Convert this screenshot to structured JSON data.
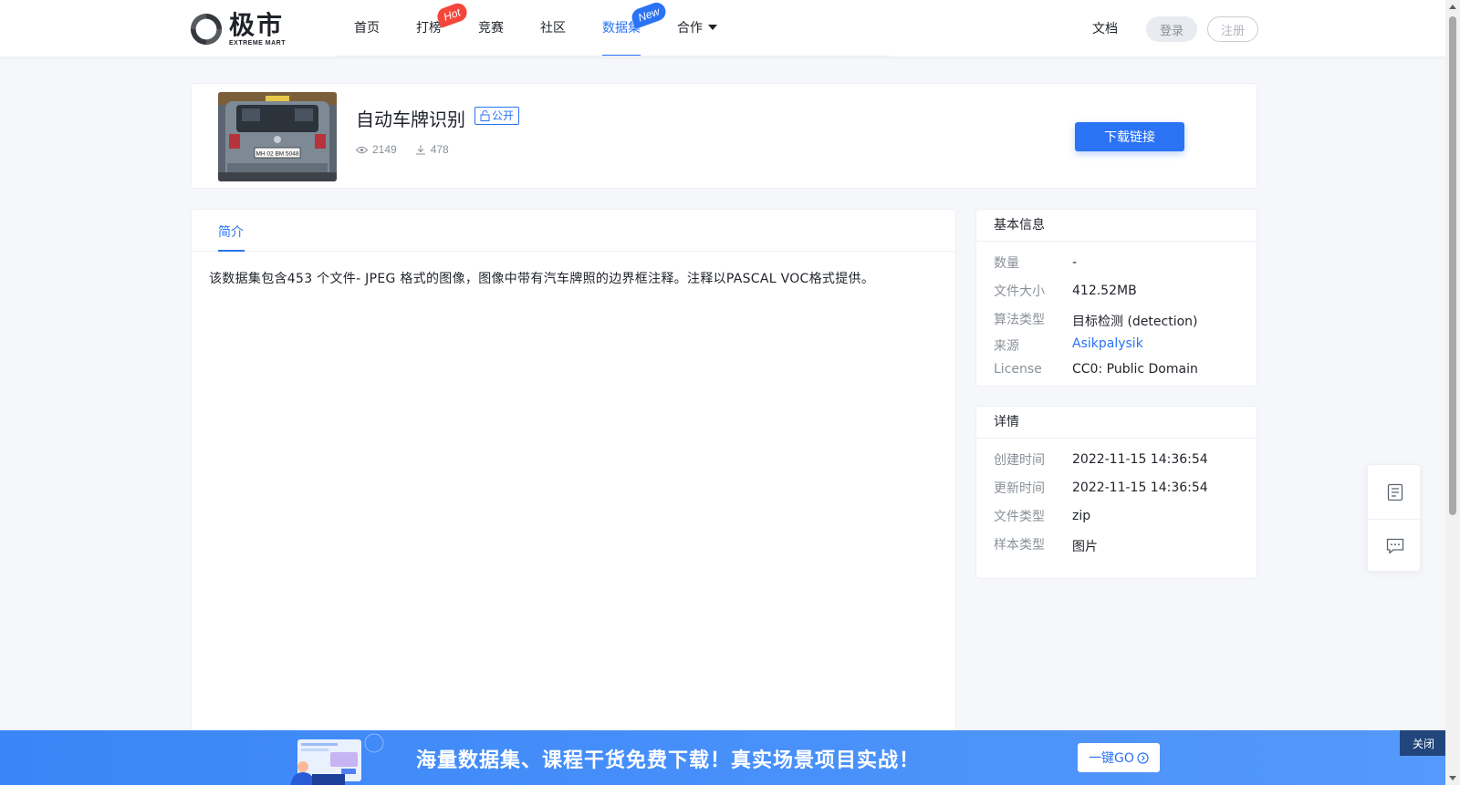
{
  "header": {
    "logo_cn": "极市",
    "logo_en": "EXTREME MART",
    "nav": [
      {
        "label": "首页"
      },
      {
        "label": "打榜",
        "badge": "Hot"
      },
      {
        "label": "竞赛"
      },
      {
        "label": "社区"
      },
      {
        "label": "数据集",
        "badge": "New",
        "active": true
      },
      {
        "label": "合作",
        "dropdown": true
      }
    ],
    "docs": "文档",
    "login": "登录",
    "register": "注册"
  },
  "dataset": {
    "title": "自动车牌识别",
    "visibility": "公开",
    "views": "2149",
    "downloads": "478",
    "download_button": "下载链接",
    "plate_text": "MH 02 BM 5048"
  },
  "intro": {
    "tab": "简介",
    "text": "该数据集包含453 个文件- JPEG 格式的图像，图像中带有汽车牌照的边界框注释。注释以PASCAL VOC格式提供。"
  },
  "basic_info": {
    "title": "基本信息",
    "rows": [
      {
        "key": "数量",
        "value": "-"
      },
      {
        "key": "文件大小",
        "value": "412.52MB"
      },
      {
        "key": "算法类型",
        "value": "目标检测 (detection)"
      },
      {
        "key": "来源",
        "value": "Asikpalysik"
      },
      {
        "key": "License",
        "value": "CC0: Public Domain"
      }
    ]
  },
  "details": {
    "title": "详情",
    "rows": [
      {
        "key": "创建时间",
        "value": "2022-11-15 14:36:54"
      },
      {
        "key": "更新时间",
        "value": "2022-11-15 14:36:54"
      },
      {
        "key": "文件类型",
        "value": "zip"
      },
      {
        "key": "样本类型",
        "value": "图片"
      }
    ]
  },
  "banner": {
    "text": "海量数据集、课程干货免费下载！真实场景项目实战！",
    "go": "一键GO",
    "close": "关闭"
  },
  "colors": {
    "accent": "#2a73f5",
    "hot": "#f5463b",
    "banner": "#3a86f8"
  }
}
